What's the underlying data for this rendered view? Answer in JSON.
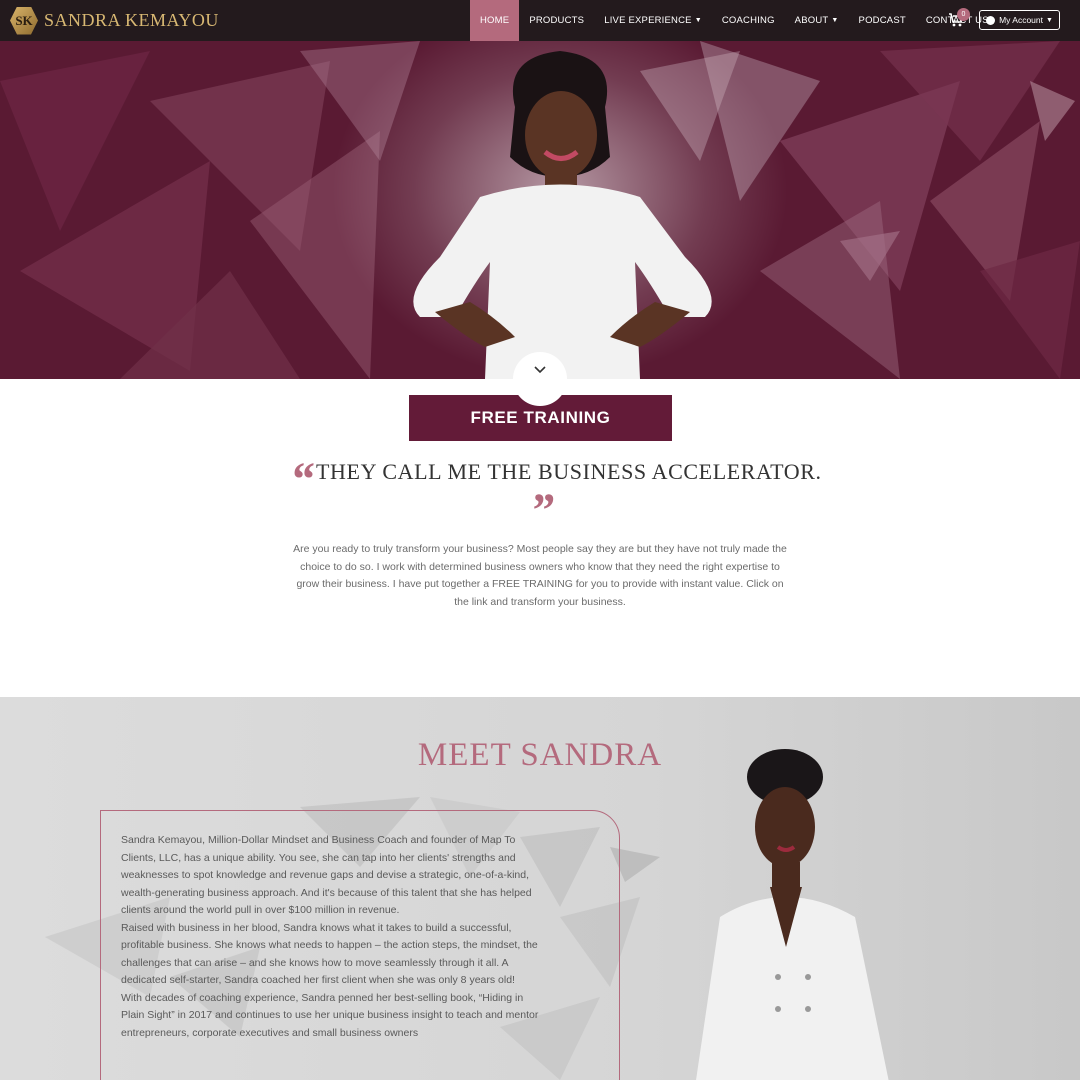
{
  "nav": {
    "brand_initials": "SK",
    "brand_name": "SANDRA KEMAYOU",
    "items": [
      {
        "label": "HOME",
        "active": true,
        "dropdown": false
      },
      {
        "label": "PRODUCTS",
        "active": false,
        "dropdown": false
      },
      {
        "label": "LIVE EXPERIENCE",
        "active": false,
        "dropdown": true
      },
      {
        "label": "COACHING",
        "active": false,
        "dropdown": false
      },
      {
        "label": "ABOUT",
        "active": false,
        "dropdown": true
      },
      {
        "label": "PODCAST",
        "active": false,
        "dropdown": false
      },
      {
        "label": "CONTACT US",
        "active": false,
        "dropdown": false
      }
    ],
    "cart_count": "0",
    "account_label": "My Account"
  },
  "hero": {
    "icons": [
      "chevron-down-icon"
    ]
  },
  "intro": {
    "cta_label": "FREE TRAINING",
    "quote_open": "“",
    "headline": "THEY CALL ME THE BUSINESS ACCELERATOR.",
    "quote_close": "”",
    "body": "Are you ready to truly transform your business? Most people say they are but they have not truly made the choice to do so. I work with determined business owners who know that they need the right expertise to grow their business. I have put together a FREE TRAINING for you to provide with instant value. Click on the link and transform your business."
  },
  "meet": {
    "title": "MEET SANDRA",
    "paragraphs": [
      "Sandra Kemayou, Million-Dollar Mindset and Business Coach and founder of Map To Clients, LLC, has a unique ability. You see, she can tap into her clients' strengths and weaknesses to spot knowledge and revenue gaps and devise a strategic, one-of-a-kind, wealth-generating business approach. And it's because of this talent that she has helped clients around the world pull in over $100 million in revenue.",
      "Raised with business in her blood, Sandra knows what it takes to build a successful, profitable business. She knows what needs to happen – the action steps, the mindset, the challenges that can arise – and she knows how to move seamlessly through it all. A dedicated self-starter, Sandra coached her first client when she was only 8 years old!",
      "With decades of coaching experience, Sandra penned her best-selling book, “Hiding in Plain Sight” in 2017 and continues to use her unique business insight to teach and mentor entrepreneurs, corporate executives and small business owners"
    ]
  },
  "colors": {
    "nav_bg": "#231a1d",
    "accent": "#b46a7d",
    "hero_bg": "#5a1a33",
    "cta_bg": "#631b38",
    "gold": "#d8b873"
  }
}
